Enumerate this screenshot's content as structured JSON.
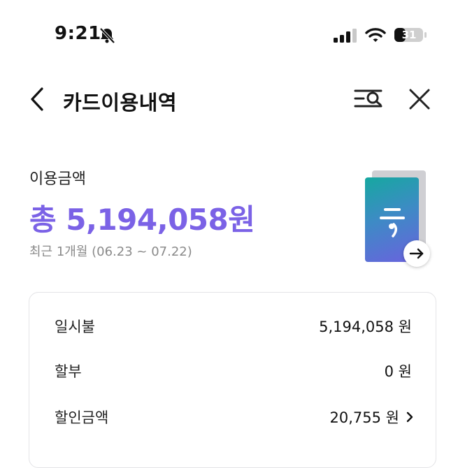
{
  "status_bar": {
    "time": "9:21",
    "battery_level": "31",
    "icons": [
      "bell-muted-icon",
      "cellular-signal-icon",
      "wifi-icon",
      "battery-icon"
    ]
  },
  "nav": {
    "title": "카드이용내역",
    "back_icon": "chevron-left-icon",
    "filter_icon": "search-filter-icon",
    "close_icon": "close-icon"
  },
  "summary": {
    "label": "이용금액",
    "total": "총 5,194,058원",
    "period": "최근 1개월 (06.23 ~ 07.22)"
  },
  "card": {
    "arrow_icon": "arrow-right-icon"
  },
  "breakdown": {
    "rows": [
      {
        "label": "일시불",
        "value": "5,194,058 원"
      },
      {
        "label": "할부",
        "value": "0 원"
      },
      {
        "label": "할인금액",
        "value": "20,755 원",
        "chevron": "chevron-right-icon"
      }
    ]
  },
  "colors": {
    "accent": "#7B62E6",
    "muted_text": "#8a8a8a",
    "border": "#e3e3e6"
  }
}
